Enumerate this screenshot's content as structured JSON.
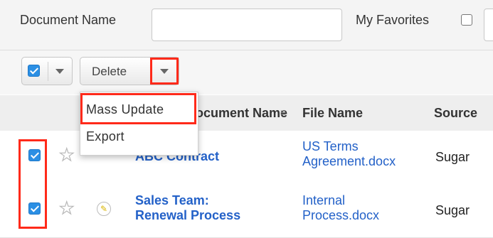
{
  "filter": {
    "document_name_label": "Document Name",
    "document_name_value": "",
    "favorites_label": "My Favorites",
    "favorites_checked": false
  },
  "toolbar": {
    "select_all_checked": true,
    "delete_label": "Delete",
    "actions_menu": [
      "Mass Update",
      "Export"
    ],
    "highlight_color": "#ff2a1a"
  },
  "table": {
    "columns": [
      "Document Name",
      "File Name",
      "Source"
    ],
    "rows": [
      {
        "checked": true,
        "favorite": false,
        "document_name": "ABC Contract",
        "file_name_line1": "US Terms",
        "file_name_line2": "Agreement.docx",
        "source": "Sugar"
      },
      {
        "checked": true,
        "favorite": false,
        "document_name_line1": "Sales Team:",
        "document_name_line2": "Renewal Process",
        "file_name_line1": "Internal",
        "file_name_line2": "Process.docx",
        "source": "Sugar"
      }
    ]
  },
  "colors": {
    "link": "#2361c8",
    "checkbox": "#2b8fe4",
    "highlight": "#ff2a1a"
  }
}
